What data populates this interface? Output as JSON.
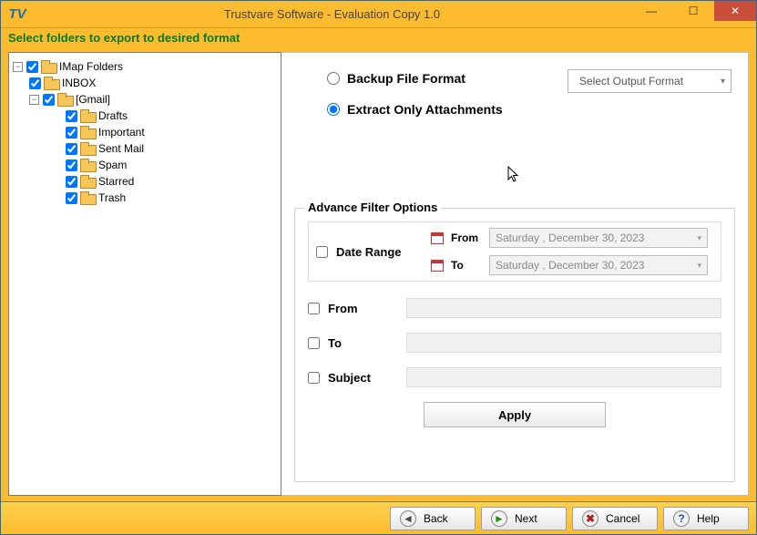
{
  "window": {
    "title": "Trustvare Software - Evaluation Copy 1.0",
    "app_icon_text": "TV"
  },
  "header": {
    "instruction": "Select folders to export to desired format"
  },
  "tree": {
    "root_label": "IMap Folders",
    "inbox": "INBOX",
    "gmail": "[Gmail]",
    "drafts": "Drafts",
    "important": "Important",
    "sentmail": "Sent Mail",
    "spam": "Spam",
    "starred": "Starred",
    "trash": "Trash"
  },
  "options": {
    "backup_label": "Backup File Format",
    "extract_label": "Extract Only Attachments",
    "output_placeholder": "Select Output Format",
    "selected_radio": "extract"
  },
  "filters": {
    "legend": "Advance Filter Options",
    "date_range_label": "Date Range",
    "from_label": "From",
    "to_label": "To",
    "subject_label": "Subject",
    "date_from_value": "Saturday , December 30, 2023",
    "date_to_value": "Saturday , December 30, 2023",
    "apply_label": "Apply"
  },
  "footer": {
    "back": "Back",
    "next": "Next",
    "cancel": "Cancel",
    "help": "Help"
  }
}
